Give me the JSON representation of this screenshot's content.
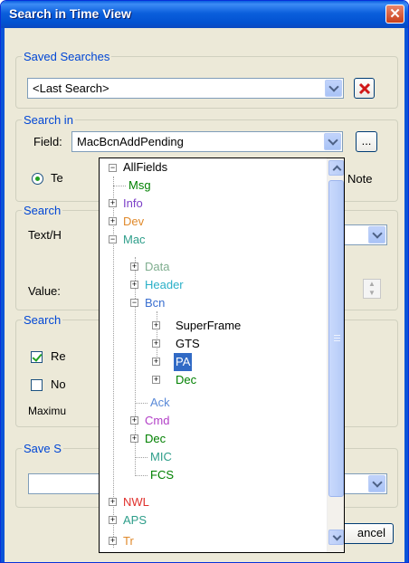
{
  "window": {
    "title": "Search in Time View"
  },
  "saved_searches": {
    "legend": "Saved Searches",
    "value": "<Last Search>"
  },
  "search_in": {
    "legend": "Search in",
    "field_label": "Field:",
    "field_value": "MacBcnAddPending",
    "browse_label": "...",
    "radio_text_partial": "Te",
    "radio_note": "Note"
  },
  "search_for": {
    "legend_partial": "Search",
    "text_label_partial": "Text/H",
    "value_label": "Value:"
  },
  "options": {
    "legend_partial": "Search",
    "check1_partial": "Re",
    "check1_checked": true,
    "check2_partial": "No",
    "check2_checked": false,
    "maximum_partial": "Maximu"
  },
  "save_search": {
    "legend_partial": "Save S"
  },
  "buttons": {
    "cancel_partial": "ancel"
  },
  "tree": {
    "root": "AllFields",
    "nodes": [
      {
        "label": "Msg",
        "color": "#008000"
      },
      {
        "label": "Info",
        "color": "#7b3fc7"
      },
      {
        "label": "Dev",
        "color": "#e08a2c"
      },
      {
        "label": "Mac",
        "color": "#2e9e8a"
      },
      {
        "label": "Data",
        "color": "#7fae8f"
      },
      {
        "label": "Header",
        "color": "#2ab0c8"
      },
      {
        "label": "Bcn",
        "color": "#3a6fd0"
      },
      {
        "label": "SuperFrame",
        "color": "#000000"
      },
      {
        "label": "GTS",
        "color": "#000000"
      },
      {
        "label": "PA",
        "color": "#ffffff"
      },
      {
        "label": "Dec",
        "color": "#008000"
      },
      {
        "label": "Ack",
        "color": "#5a8ad8"
      },
      {
        "label": "Cmd",
        "color": "#b23fc7"
      },
      {
        "label": "Dec",
        "color": "#008000"
      },
      {
        "label": "MIC",
        "color": "#2e9e8a"
      },
      {
        "label": "FCS",
        "color": "#008000"
      },
      {
        "label": "NWL",
        "color": "#e0302c"
      },
      {
        "label": "APS",
        "color": "#2e9e8a"
      },
      {
        "label": "Tr",
        "color": "#e08a2c"
      }
    ],
    "selected": "PA"
  }
}
